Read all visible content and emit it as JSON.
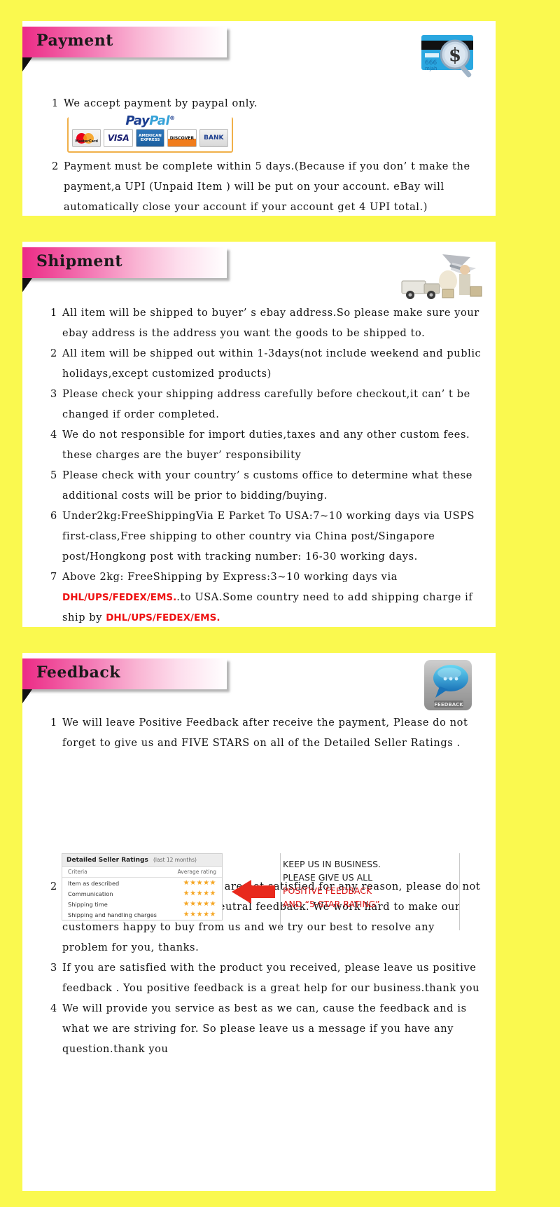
{
  "theme": {
    "page_bg": "#FAF94F",
    "panel_bg": "#FFFFFF",
    "ribbon_pink": "#EC2B86",
    "red_text": "#EE1111",
    "star_gold": "#F5A623"
  },
  "sections": {
    "payment": {
      "title": "Payment",
      "icon": "credit-card-magnifier-dollar-icon",
      "items": [
        {
          "num": "1",
          "text": "We accept payment by paypal only."
        },
        {
          "num": "2",
          "text": "Payment must be complete within 5 days.(Because if you don’ t make the payment,a UPI (Unpaid Item ) will be put on your account. eBay will automatically close your account if your account get 4 UPI total.)"
        }
      ],
      "paypal": {
        "brand_first": "Pay",
        "brand_second": "Pal",
        "trademark": "®",
        "cards": [
          {
            "name": "mastercard",
            "label": "MasterCard"
          },
          {
            "name": "visa",
            "label": "VISA"
          },
          {
            "name": "american-express",
            "label": "AMERICAN EXPRESS"
          },
          {
            "name": "discover",
            "label": "DISCOVER"
          },
          {
            "name": "bank",
            "label": "BANK"
          }
        ]
      }
    },
    "shipment": {
      "title": "Shipment",
      "icon": "airplane-truck-delivery-icon",
      "items": [
        {
          "num": "1",
          "text": "All item will be shipped to buyer’ s ebay address.So please make sure your ebay address is the address you want the goods to be shipped to."
        },
        {
          "num": "2",
          "text": "All item will be shipped out within 1-3days(not include weekend and public holidays,except customized products)"
        },
        {
          "num": "3",
          "text": "Please check your shipping address carefully before checkout,it can’ t be changed if order completed."
        },
        {
          "num": "4",
          "text": "We do not responsible for import duties,taxes and any other custom fees. these charges are the buyer’ responsibility"
        },
        {
          "num": "5",
          "text": "Please check with your country’ s customs office to determine what these additional costs will be prior to bidding/buying."
        },
        {
          "num": "6",
          "text": "Under2kg:FreeShippingVia E Parket To USA:7~10 working days via USPS first-class,Free shipping to other country via China post/Singapore post/Hongkong post with tracking number: 16-30 working days."
        },
        {
          "num": "7",
          "text_before": "Above 2kg: FreeShipping by Express:3~10 working days via ",
          "red_1": "DHL/UPS/FEDEX/EMS.",
          "text_mid": ".to USA.Some country need to add shipping charge if ship by ",
          "red_2": "DHL/UPS/FEDEX/EMS."
        }
      ]
    },
    "feedback": {
      "title": "Feedback",
      "icon": "blue-speech-bubble-feedback-icon",
      "icon_label": "FEEDBACK",
      "items_top": [
        {
          "num": "1",
          "text": "We will leave Positive Feedback after receive the payment, Please do not forget to give us and FIVE STARS on all of the Detailed Seller Ratings ."
        }
      ],
      "ratings_table": {
        "title": "Detailed Seller Ratings",
        "period": "(last 12 months)",
        "col_criteria": "Criteria",
        "col_average": "Average rating",
        "rows": [
          {
            "criteria": "Item as described",
            "stars": "★★★★★"
          },
          {
            "criteria": "Communication",
            "stars": "★★★★★"
          },
          {
            "criteria": "Shipping time",
            "stars": "★★★★★"
          },
          {
            "criteria": "Shipping and handling charges",
            "stars": "★★★★★"
          }
        ]
      },
      "callout": {
        "line1": "KEEP US IN BUSINESS.",
        "line2": "PLEASE GIVE US ALL",
        "line3_red": "POSITIVE FEEDBACK",
        "line4_red": "AND “5-STAR RATING”"
      },
      "items_bottom": [
        {
          "num": "2",
          "text": "Please contact us first,if you are not satisfied for any reason, please do not be quick to leave negative/neutral feedback. We work hard to make our customers happy to buy from us and we try our best to resolve any problem for you, thanks."
        },
        {
          "num": "3",
          "text": "If you are satisfied with the product you received, please leave us positive feedback . You positive feedback is a great help for our business.thank you"
        },
        {
          "num": "4",
          "text": "We will provide you service as best as we can, cause the feedback and is what we are striving for. So please leave us a message if you have any question.thank you"
        }
      ]
    }
  }
}
